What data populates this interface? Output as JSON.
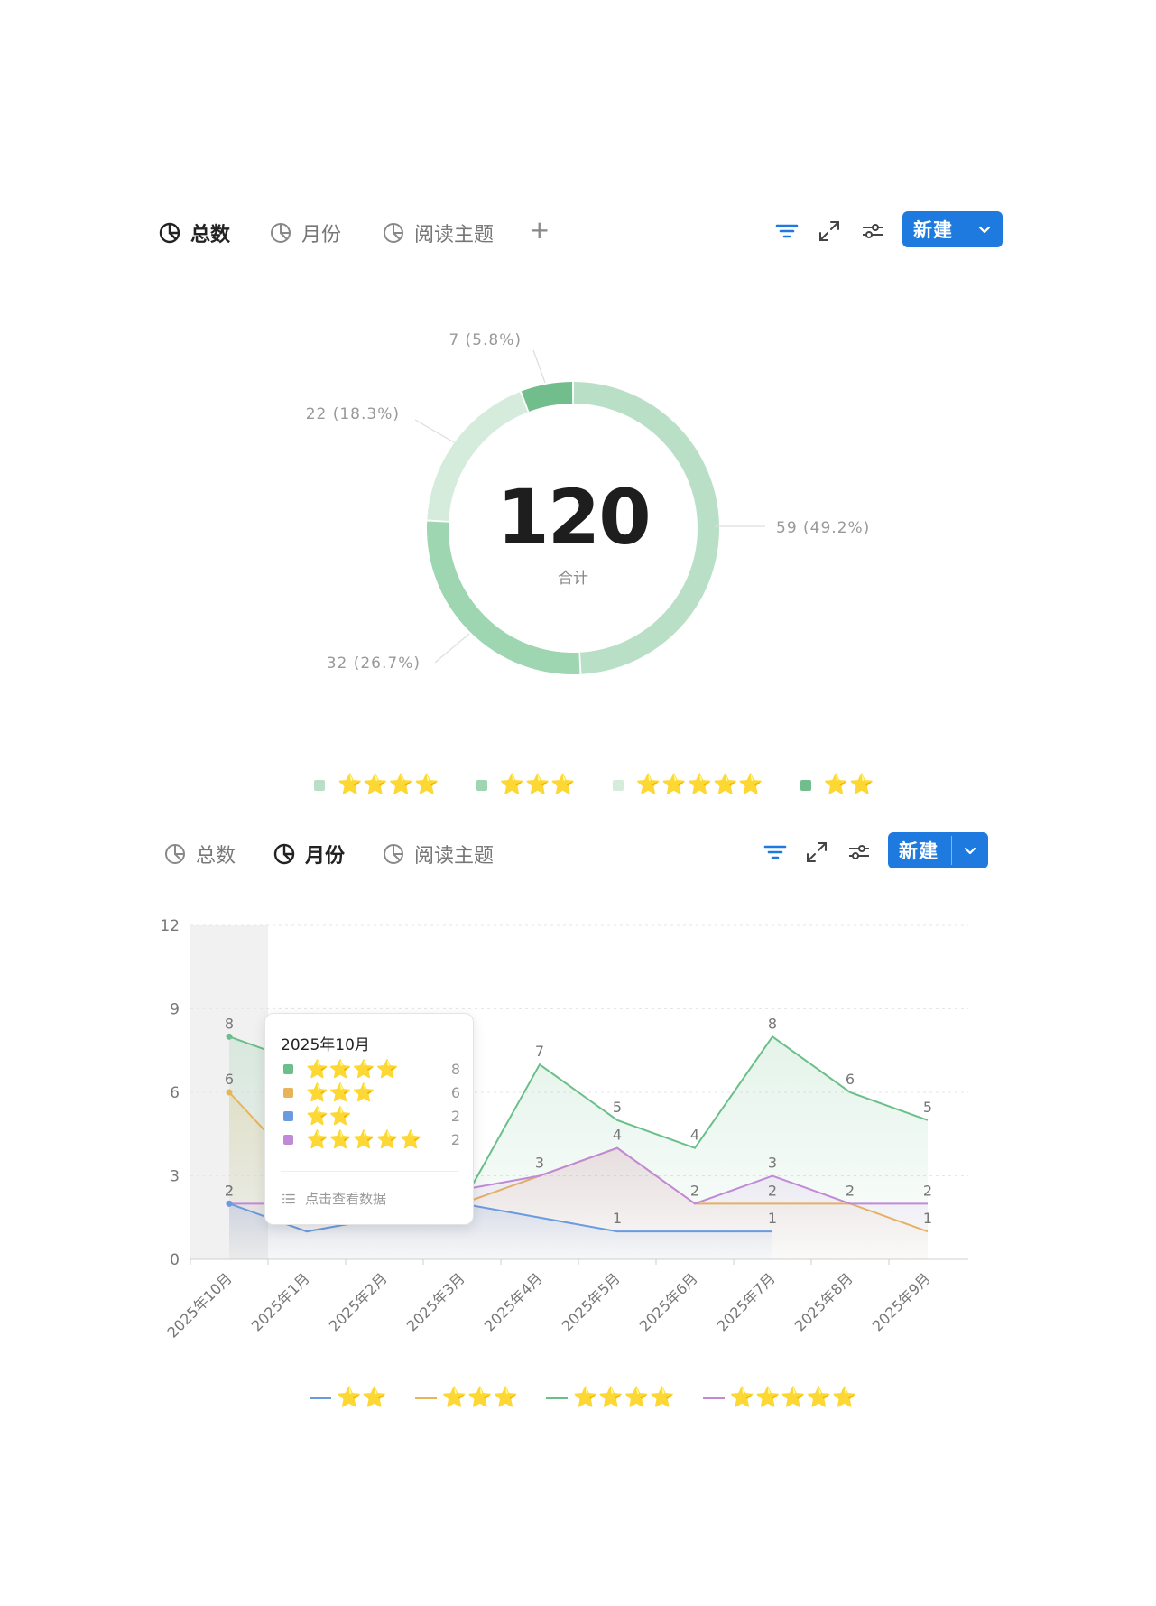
{
  "toolbar_top": {
    "tabs": [
      {
        "label": "总数",
        "active": true
      },
      {
        "label": "月份",
        "active": false
      },
      {
        "label": "阅读主题",
        "active": false
      }
    ],
    "add_label": "+",
    "new_label": "新建",
    "icons": [
      "filter-icon",
      "expand-icon",
      "settings-sliders-icon",
      "chevron-down-icon"
    ]
  },
  "toolbar_bottom": {
    "tabs": [
      {
        "label": "总数",
        "active": false
      },
      {
        "label": "月份",
        "active": true
      },
      {
        "label": "阅读主题",
        "active": false
      }
    ],
    "new_label": "新建"
  },
  "colors": {
    "accent": "#1f7ae0",
    "star": "#f5b800",
    "two_star": "#6a9be0",
    "three_star": "#e8b45a",
    "four_star": "#6abf8a",
    "five_star": "#c08ad9"
  },
  "donut": {
    "total": "120",
    "total_label": "合计"
  },
  "tooltip": {
    "title": "2025年10月",
    "rows": [
      {
        "stars": "⭐⭐⭐⭐",
        "value": "8",
        "color": "#6abf8a"
      },
      {
        "stars": "⭐⭐⭐",
        "value": "6",
        "color": "#e8b45a"
      },
      {
        "stars": "⭐⭐",
        "value": "2",
        "color": "#6a9be0"
      },
      {
        "stars": "⭐⭐⭐⭐⭐",
        "value": "2",
        "color": "#c08ad9"
      }
    ],
    "link": "点击查看数据"
  },
  "chart_data": [
    {
      "type": "pie",
      "title": "",
      "total": 120,
      "slices": [
        {
          "name": "⭐⭐⭐⭐",
          "value": 59,
          "label": "59 (49.2%)",
          "color": "#b9e0c6"
        },
        {
          "name": "⭐⭐⭐",
          "value": 32,
          "label": "32 (26.7%)",
          "color": "#9ed6b1"
        },
        {
          "name": "⭐⭐⭐⭐⭐",
          "value": 22,
          "label": "22 (18.3%)",
          "color": "#d5ecdd"
        },
        {
          "name": "⭐⭐",
          "value": 7,
          "label": "7 (5.8%)",
          "color": "#72bd8c"
        }
      ],
      "legend_placement": "bottom"
    },
    {
      "type": "line",
      "title": "",
      "xlabel": "",
      "ylabel": "",
      "categories": [
        "2025年10月",
        "2025年1月",
        "2025年2月",
        "2025年3月",
        "2025年4月",
        "2025年5月",
        "2025年6月",
        "2025年7月",
        "2025年8月",
        "2025年9月"
      ],
      "ylim": [
        0,
        12
      ],
      "yticks": [
        "0",
        "3",
        "6",
        "9",
        "12"
      ],
      "grid": true,
      "legend_placement": "bottom",
      "highlight_category": "2025年10月",
      "series": [
        {
          "name": "⭐⭐",
          "color": "#6a9be0",
          "values": [
            2,
            1,
            1.5,
            2,
            1.5,
            1,
            1,
            1,
            null,
            null
          ],
          "labels": [
            "2",
            "1",
            null,
            null,
            null,
            "1",
            null,
            "1",
            null,
            null
          ]
        },
        {
          "name": "⭐⭐⭐",
          "color": "#e8b45a",
          "values": [
            6,
            3,
            2,
            2,
            3,
            4,
            2,
            2,
            2,
            1
          ],
          "labels": [
            "6",
            null,
            null,
            null,
            null,
            null,
            null,
            null,
            null,
            "1"
          ]
        },
        {
          "name": "⭐⭐⭐⭐",
          "color": "#6abf8a",
          "values": [
            8,
            7,
            2,
            2,
            7,
            5,
            4,
            8,
            6,
            5
          ],
          "labels": [
            "8",
            null,
            null,
            null,
            "7",
            "5",
            "4",
            "8",
            "6",
            "5"
          ]
        },
        {
          "name": "⭐⭐⭐⭐⭐",
          "color": "#c08ad9",
          "values": [
            2,
            2,
            2,
            2.5,
            3,
            4,
            2,
            3,
            2,
            2
          ],
          "labels": [
            "2",
            null,
            null,
            null,
            "3",
            "4",
            "2",
            "3",
            "2",
            "2"
          ]
        }
      ],
      "extra_labels": [
        {
          "x": "2025年7月",
          "y": 2,
          "text": "2"
        },
        {
          "x": "2025年1月",
          "y": 1,
          "text": "1"
        }
      ]
    }
  ]
}
